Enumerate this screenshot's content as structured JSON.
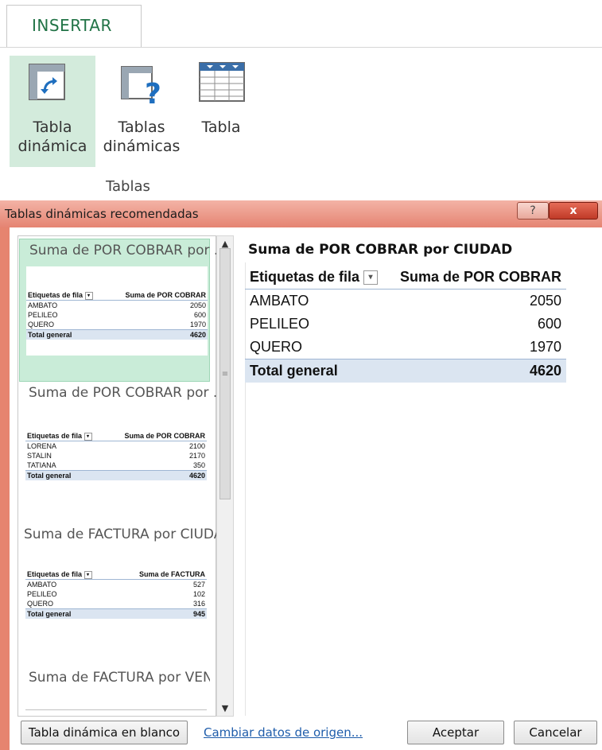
{
  "ribbon": {
    "tab_label": "INSERTAR",
    "buttons": [
      {
        "line1": "Tabla",
        "line2": "dinámica",
        "icon": "pivot-table-icon"
      },
      {
        "line1": "Tablas",
        "line2": "dinámicas",
        "icon": "recommended-pivot-icon"
      },
      {
        "line1": "Tabla",
        "line2": "",
        "icon": "table-icon"
      }
    ],
    "group_label": "Tablas"
  },
  "dialog": {
    "title": "Tablas dinámicas recomendadas",
    "help": "?",
    "close": "x",
    "cards": [
      {
        "title": "Suma de POR COBRAR por ...",
        "col1": "Etiquetas de fila",
        "col2": "Suma de POR COBRAR",
        "rows": [
          [
            "AMBATO",
            "2050"
          ],
          [
            "PELILEO",
            "600"
          ],
          [
            "QUERO",
            "1970"
          ]
        ],
        "total": [
          "Total general",
          "4620"
        ]
      },
      {
        "title": "Suma de POR COBRAR por ...",
        "col1": "Etiquetas de fila",
        "col2": "Suma de POR COBRAR",
        "rows": [
          [
            "LORENA",
            "2100"
          ],
          [
            "STALIN",
            "2170"
          ],
          [
            "TATIANA",
            "350"
          ]
        ],
        "total": [
          "Total general",
          "4620"
        ]
      },
      {
        "title": "Suma de FACTURA por CIUDAD",
        "col1": "Etiquetas de fila",
        "col2": "Suma de FACTURA",
        "rows": [
          [
            "AMBATO",
            "527"
          ],
          [
            "PELILEO",
            "102"
          ],
          [
            "QUERO",
            "316"
          ]
        ],
        "total": [
          "Total general",
          "945"
        ]
      },
      {
        "title": "Suma de FACTURA por VEN..."
      }
    ],
    "preview": {
      "title": "Suma de POR COBRAR por CIUDAD",
      "col1": "Etiquetas de fila",
      "col2": "Suma de POR COBRAR",
      "rows": [
        [
          "AMBATO",
          "2050"
        ],
        [
          "PELILEO",
          "600"
        ],
        [
          "QUERO",
          "1970"
        ]
      ],
      "total": [
        "Total general",
        "4620"
      ]
    },
    "buttons": {
      "blank": "Tabla dinámica en blanco",
      "change_source": "Cambiar datos de origen...",
      "accept": "Aceptar",
      "cancel": "Cancelar"
    }
  }
}
